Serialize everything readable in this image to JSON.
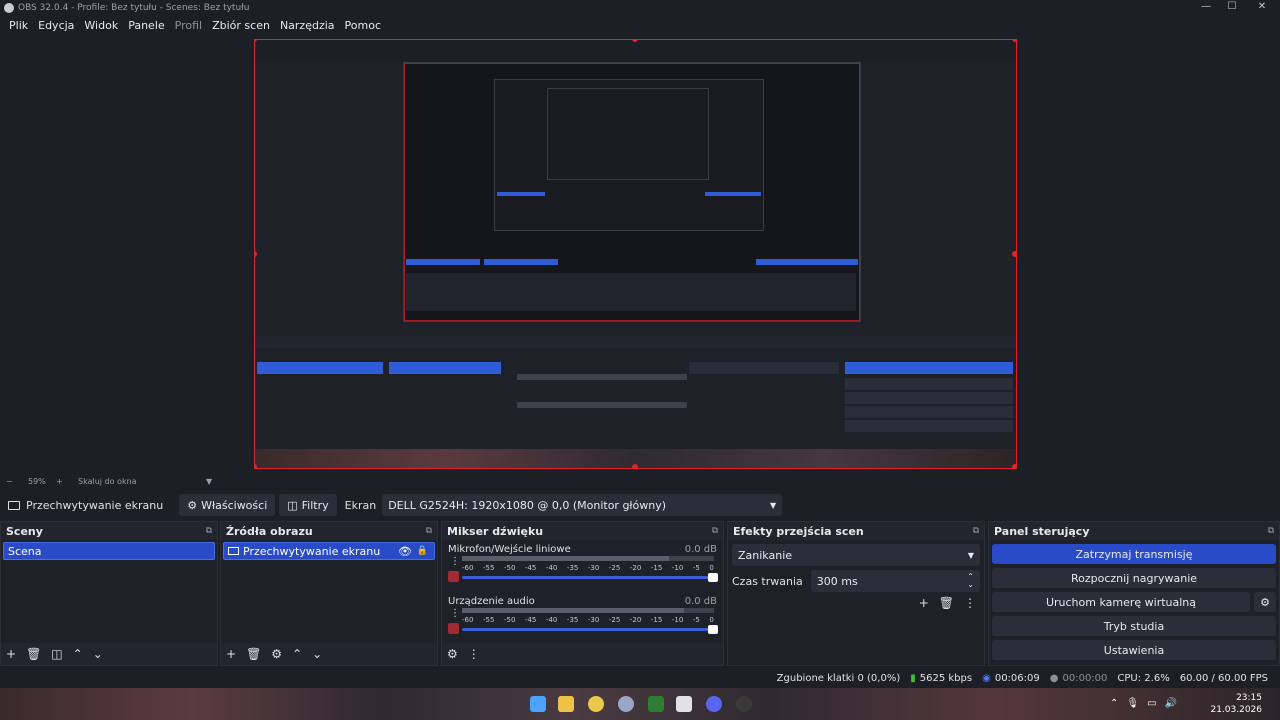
{
  "window": {
    "title": "OBS 32.0.4 - Profile: Bez tytułu - Scenes: Bez tytułu",
    "controls": {
      "minimize": "—",
      "maximize": "☐",
      "close": "✕"
    }
  },
  "menu": {
    "items": [
      "Plik",
      "Edycja",
      "Widok",
      "Panele",
      "Profil",
      "Zbiór scen",
      "Narzędzia",
      "Pomoc"
    ]
  },
  "zoom": {
    "minus": "−",
    "value": "59%",
    "plus": "+",
    "fit_label": "Skaluj do okna"
  },
  "context": {
    "source_name": "Przechwytywanie ekranu",
    "properties_label": "Właściwości",
    "filters_label": "Filtry",
    "screen_label": "Ekran",
    "screen_value": "DELL G2524H: 1920x1080 @ 0,0 (Monitor główny)"
  },
  "scenes": {
    "title": "Sceny",
    "items": [
      "Scena"
    ]
  },
  "sources": {
    "title": "Źródła obrazu",
    "items": [
      "Przechwytywanie ekranu"
    ]
  },
  "mixer": {
    "title": "Mikser dźwięku",
    "tracks": [
      {
        "name": "Mikrofon/Wejście liniowe",
        "db": "0.0 dB",
        "level": 0.82
      },
      {
        "name": "Urządzenie audio",
        "db": "0.0 dB",
        "level": 0.88
      }
    ],
    "ticks": [
      "-60",
      "-55",
      "-50",
      "-45",
      "-40",
      "-35",
      "-30",
      "-25",
      "-20",
      "-15",
      "-10",
      "-5",
      "0"
    ]
  },
  "transitions": {
    "title": "Efekty przejścia scen",
    "effect": "Zanikanie",
    "duration_label": "Czas trwania",
    "duration_value": "300 ms"
  },
  "controls": {
    "title": "Panel sterujący",
    "stop_stream": "Zatrzymaj transmisję",
    "start_record": "Rozpocznij nagrywanie",
    "virtual_cam": "Uruchom kamerę wirtualną",
    "studio_mode": "Tryb studia",
    "settings": "Ustawienia"
  },
  "status": {
    "dropped": "Zgubione klatki 0 (0,0%)",
    "bitrate": "5625 kbps",
    "stream_time": "00:06:09",
    "record_time": "00:00:00",
    "cpu": "CPU: 2.6%",
    "fps": "60.00 / 60.00 FPS"
  },
  "clock": {
    "time": "23:15",
    "date": "21.03.2026"
  },
  "colors": {
    "accent": "#2a4bc7",
    "selection_frame": "#e0242f",
    "background": "#1d1f26"
  }
}
